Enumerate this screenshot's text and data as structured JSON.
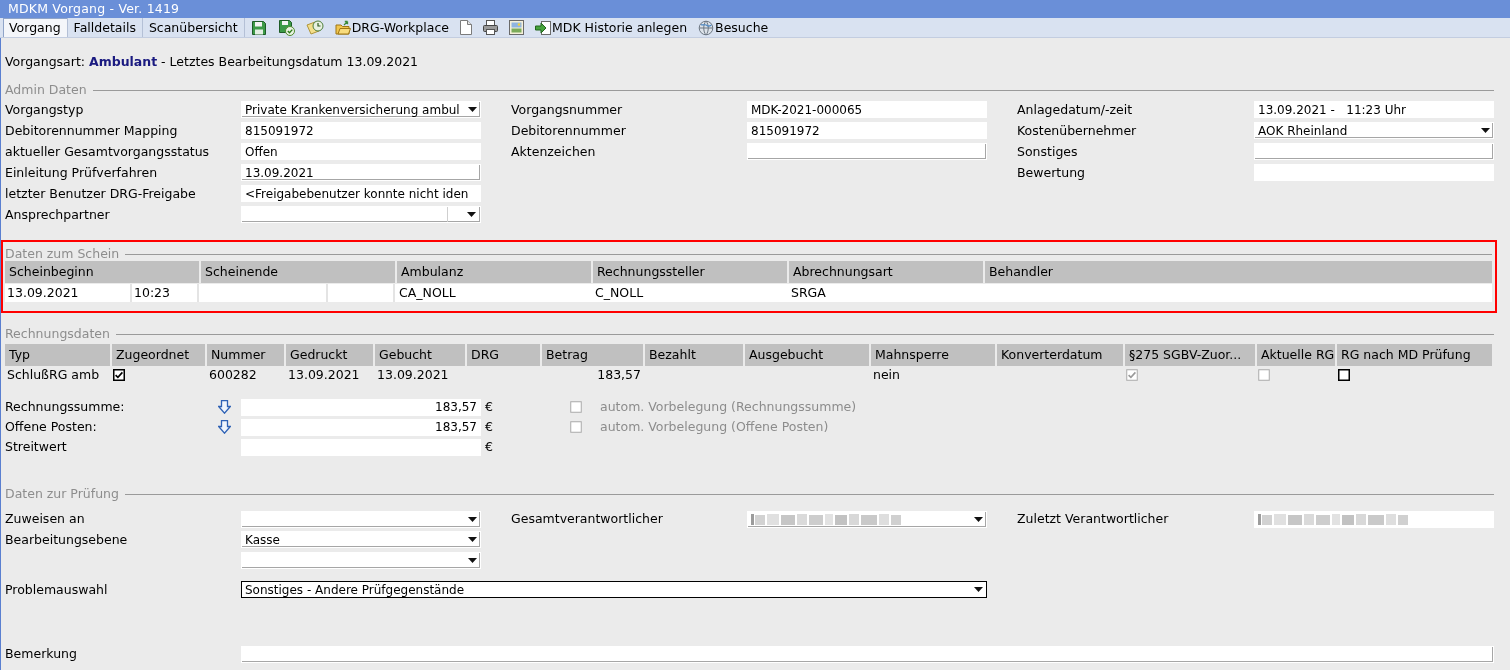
{
  "window": {
    "title": "MDKM Vorgang - Ver. 1419"
  },
  "tabs": [
    {
      "label": "Vorgang",
      "selected": true
    },
    {
      "label": "Falldetails",
      "selected": false
    },
    {
      "label": "Scanübersicht",
      "selected": false
    }
  ],
  "toolbar": [
    {
      "kind": "save"
    },
    {
      "kind": "save_check"
    },
    {
      "kind": "clock"
    },
    {
      "kind": "folder",
      "label": "DRG-Workplace"
    },
    {
      "kind": "document"
    },
    {
      "kind": "print"
    },
    {
      "kind": "picture"
    },
    {
      "kind": "import",
      "label": "MDK Historie anlegen"
    },
    {
      "kind": "globe",
      "label": "Besuche"
    }
  ],
  "summary": "Vorgangsart: **Ambulant** - Letztes Bearbeitungsdatum 13.09.2021",
  "admin": {
    "title": "Admin Daten",
    "columns": [
      {
        "fields": [
          {
            "label": "Vorgangstyp",
            "kind": "dropdown",
            "value": "Private Krankenversicherung ambul"
          },
          {
            "label": "Debitorennummer Mapping",
            "kind": "readonly",
            "value": "815091972"
          },
          {
            "label": "aktueller Gesamtvorgangsstatus",
            "kind": "readonly",
            "value": "Offen"
          },
          {
            "label": "Einleitung Prüfverfahren",
            "kind": "input",
            "value": "13.09.2021"
          },
          {
            "label": "letzter Benutzer DRG-Freigabe",
            "kind": "readonly",
            "value": "<Freigabebenutzer konnte nicht iden"
          },
          {
            "label": "Ansprechpartner",
            "kind": "combo"
          }
        ]
      },
      {
        "fields": [
          {
            "label": "Vorgangsnummer",
            "kind": "readonly",
            "value": "MDK-2021-000065"
          },
          {
            "label": "Debitorennummer",
            "kind": "readonly",
            "value": "815091972"
          },
          {
            "label": "Aktenzeichen",
            "kind": "input"
          }
        ]
      },
      {
        "fields": [
          {
            "label": "Anlagedatum/-zeit",
            "kind": "readonly",
            "value": "13.09.2021 -   11:23 Uhr"
          },
          {
            "label": "Kostenübernehmer",
            "kind": "dropdown",
            "value": "AOK Rheinland"
          },
          {
            "label": "Sonstiges",
            "kind": "input"
          },
          {
            "label": "Bewertung",
            "kind": "readonly"
          }
        ]
      }
    ]
  },
  "schein": {
    "title": "Daten zum Schein",
    "highlighted": true,
    "columns": [
      "Scheinbeginn",
      "Scheinende",
      "Ambulanz",
      "Rechnungssteller",
      "Abrechnungsart",
      "Behandler"
    ],
    "rows": [
      {
        "cells": [
          {
            "kind": "date_time",
            "date": "13.09.2021",
            "time": "10:23"
          },
          {
            "kind": "date_time"
          },
          {
            "kind": "text",
            "text": "CA_NOLL"
          },
          {
            "kind": "text",
            "text": "C_NOLL"
          },
          {
            "kind": "text",
            "text": "SRGA"
          },
          {
            "kind": "text"
          }
        ]
      }
    ]
  },
  "rechnung": {
    "title": "Rechnungsdaten",
    "columns": [
      "Typ",
      "Zugeordnet",
      "Nummer",
      "Gedruckt",
      "Gebucht",
      "DRG",
      "Betrag",
      "Bezahlt",
      "Ausgebucht",
      "Mahnsperre",
      "Konverterdatum",
      "§275 SGBV-Zuor...",
      "Aktuelle RG",
      "RG nach MD Prüfung"
    ],
    "rows": [
      {
        "cells": [
          {
            "kind": "text",
            "text": "SchlußRG amb"
          },
          {
            "kind": "checkbox",
            "checked": true,
            "disabled": false
          },
          {
            "kind": "text",
            "text": "600282"
          },
          {
            "kind": "text",
            "text": "13.09.2021"
          },
          {
            "kind": "text",
            "text": "13.09.2021"
          },
          {
            "kind": "text"
          },
          {
            "kind": "amount",
            "text": "183,57"
          },
          {
            "kind": "text"
          },
          {
            "kind": "text"
          },
          {
            "kind": "text",
            "text": "nein"
          },
          {
            "kind": "text"
          },
          {
            "kind": "checkbox",
            "checked": true,
            "disabled": true
          },
          {
            "kind": "checkbox",
            "checked": false,
            "disabled": true
          },
          {
            "kind": "checkbox",
            "checked": false,
            "disabled": false
          }
        ]
      }
    ],
    "totals": [
      {
        "label": "Rechnungssumme:",
        "arrow": true,
        "value": "183,57",
        "currency": "€",
        "option": {
          "label": "autom. Vorbelegung (Rechnungssumme)",
          "checked": false,
          "disabled": true
        }
      },
      {
        "label": "Offene Posten:",
        "arrow": true,
        "value": "183,57",
        "currency": "€",
        "option": {
          "label": "autom. Vorbelegung (Offene Posten)",
          "checked": false,
          "disabled": true
        }
      },
      {
        "label": "Streitwert",
        "arrow": false,
        "currency": "€"
      }
    ]
  },
  "pruefung": {
    "title": "Daten zur Prüfung",
    "rows": [
      {
        "kind": "grid",
        "fields": [
          {
            "label": "Zuweisen an",
            "kind": "dropdown",
            "redacted": false,
            "focused": false
          },
          {
            "label": "Gesamtverantwortlicher",
            "kind": "dropdown",
            "redacted": true,
            "focused": false
          },
          {
            "label": "Zuletzt Verantwortlicher",
            "kind": "readonly",
            "redacted": true,
            "focused": false
          }
        ]
      },
      {
        "kind": "grid",
        "fields": [
          {
            "label": "Bearbeitungsebene",
            "kind": "dropdown",
            "value": "Kasse",
            "redacted": false,
            "focused": false
          }
        ]
      },
      {
        "kind": "grid",
        "fields": [
          {
            "kind": "dropdown",
            "redacted": false,
            "focused": false
          }
        ]
      },
      {
        "kind": "wide",
        "fields": [
          {
            "label": "Problemauswahl",
            "kind": "dropdown",
            "value": "Sonstiges - Andere Prüfgegenstände",
            "redacted": false,
            "focused": true
          }
        ]
      },
      {
        "kind": "full",
        "fields": [
          {
            "label": "Bemerkung",
            "kind": "input",
            "redacted": false,
            "focused": false
          }
        ]
      }
    ]
  }
}
